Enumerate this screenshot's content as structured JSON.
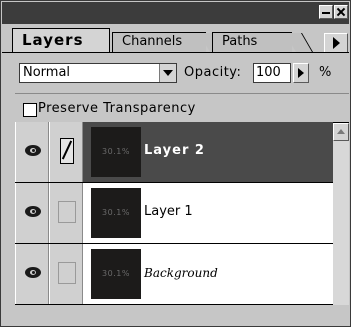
{
  "window": {
    "minimize_icon": "minimize-icon",
    "close_icon": "close-icon"
  },
  "tabs": [
    {
      "label": "Layers",
      "active": true
    },
    {
      "label": "Channels",
      "active": false
    },
    {
      "label": "Paths",
      "active": false
    }
  ],
  "palette_menu_icon": "triangle-right-icon",
  "blend": {
    "mode": "Normal",
    "opacity_label": "Opacity:",
    "opacity_value": "100",
    "percent_symbol": "%"
  },
  "preserve_transparency": {
    "label": "Preserve Transparency",
    "checked": false
  },
  "layers": [
    {
      "name": "Layer 2",
      "visible": true,
      "selected": true,
      "brush_icon": "paintbrush-icon",
      "thumbnail_text": "30.1%"
    },
    {
      "name": "Layer 1",
      "visible": true,
      "selected": false,
      "thumbnail_text": "30.1%"
    },
    {
      "name": "Background",
      "visible": true,
      "selected": false,
      "thumbnail_text": "30.1%"
    }
  ],
  "colors": {
    "selected_row": "#4a4a4a",
    "panel_bg": "#c6c6c6",
    "titlebar": "#3c3c3c"
  }
}
